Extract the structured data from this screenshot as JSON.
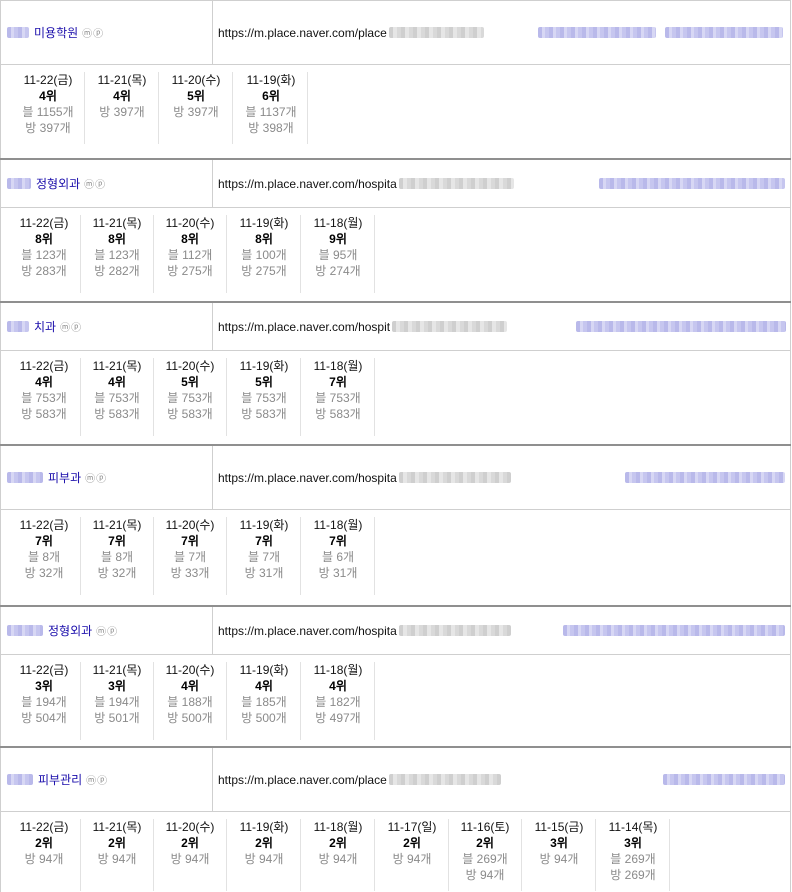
{
  "entries": [
    {
      "name": "미용학원",
      "mp": "ⓜⓟ",
      "url": "https://m.place.naver.com/place",
      "days": [
        {
          "date": "11-22(금)",
          "rank": "4위",
          "blog": "블 1155개",
          "place": "방 397개"
        },
        {
          "date": "11-21(목)",
          "rank": "4위",
          "blog": "",
          "place": "방 397개"
        },
        {
          "date": "11-20(수)",
          "rank": "5위",
          "blog": "",
          "place": "방 397개"
        },
        {
          "date": "11-19(화)",
          "rank": "6위",
          "blog": "블 1137개",
          "place": "방 398개"
        }
      ]
    },
    {
      "name": "정형외과",
      "mp": "ⓜⓟ",
      "url": "https://m.place.naver.com/hospita",
      "days": [
        {
          "date": "11-22(금)",
          "rank": "8위",
          "blog": "블 123개",
          "place": "방 283개"
        },
        {
          "date": "11-21(목)",
          "rank": "8위",
          "blog": "블 123개",
          "place": "방 282개"
        },
        {
          "date": "11-20(수)",
          "rank": "8위",
          "blog": "블 112개",
          "place": "방 275개"
        },
        {
          "date": "11-19(화)",
          "rank": "8위",
          "blog": "블 100개",
          "place": "방 275개"
        },
        {
          "date": "11-18(월)",
          "rank": "9위",
          "blog": "블 95개",
          "place": "방 274개"
        }
      ]
    },
    {
      "name": "치과",
      "mp": "ⓜⓟ",
      "url": "https://m.place.naver.com/hospit",
      "days": [
        {
          "date": "11-22(금)",
          "rank": "4위",
          "blog": "블 753개",
          "place": "방 583개"
        },
        {
          "date": "11-21(목)",
          "rank": "4위",
          "blog": "블 753개",
          "place": "방 583개"
        },
        {
          "date": "11-20(수)",
          "rank": "5위",
          "blog": "블 753개",
          "place": "방 583개"
        },
        {
          "date": "11-19(화)",
          "rank": "5위",
          "blog": "블 753개",
          "place": "방 583개"
        },
        {
          "date": "11-18(월)",
          "rank": "7위",
          "blog": "블 753개",
          "place": "방 583개"
        }
      ]
    },
    {
      "name": "피부과",
      "mp": "ⓜⓟ",
      "url": "https://m.place.naver.com/hospita",
      "days": [
        {
          "date": "11-22(금)",
          "rank": "7위",
          "blog": "블 8개",
          "place": "방 32개"
        },
        {
          "date": "11-21(목)",
          "rank": "7위",
          "blog": "블 8개",
          "place": "방 32개"
        },
        {
          "date": "11-20(수)",
          "rank": "7위",
          "blog": "블 7개",
          "place": "방 33개"
        },
        {
          "date": "11-19(화)",
          "rank": "7위",
          "blog": "블 7개",
          "place": "방 31개"
        },
        {
          "date": "11-18(월)",
          "rank": "7위",
          "blog": "블 6개",
          "place": "방 31개"
        }
      ]
    },
    {
      "name": "정형외과",
      "mp": "ⓜⓟ",
      "url": "https://m.place.naver.com/hospita",
      "days": [
        {
          "date": "11-22(금)",
          "rank": "3위",
          "blog": "블 194개",
          "place": "방 504개"
        },
        {
          "date": "11-21(목)",
          "rank": "3위",
          "blog": "블 194개",
          "place": "방 501개"
        },
        {
          "date": "11-20(수)",
          "rank": "4위",
          "blog": "블 188개",
          "place": "방 500개"
        },
        {
          "date": "11-19(화)",
          "rank": "4위",
          "blog": "블 185개",
          "place": "방 500개"
        },
        {
          "date": "11-18(월)",
          "rank": "4위",
          "blog": "블 182개",
          "place": "방 497개"
        }
      ]
    },
    {
      "name": "피부관리",
      "mp": "ⓜⓟ",
      "url": "https://m.place.naver.com/place",
      "days": [
        {
          "date": "11-22(금)",
          "rank": "2위",
          "blog": "",
          "place": "방 94개"
        },
        {
          "date": "11-21(목)",
          "rank": "2위",
          "blog": "",
          "place": "방 94개"
        },
        {
          "date": "11-20(수)",
          "rank": "2위",
          "blog": "",
          "place": "방 94개"
        },
        {
          "date": "11-19(화)",
          "rank": "2위",
          "blog": "",
          "place": "방 94개"
        },
        {
          "date": "11-18(월)",
          "rank": "2위",
          "blog": "",
          "place": "방 94개"
        },
        {
          "date": "11-17(일)",
          "rank": "2위",
          "blog": "",
          "place": "방 94개"
        },
        {
          "date": "11-16(토)",
          "rank": "2위",
          "blog": "블 269개",
          "place": "방 94개"
        },
        {
          "date": "11-15(금)",
          "rank": "3위",
          "blog": "",
          "place": "방 94개"
        },
        {
          "date": "11-14(목)",
          "rank": "3위",
          "blog": "블 269개",
          "place": "방 269개"
        }
      ]
    }
  ]
}
